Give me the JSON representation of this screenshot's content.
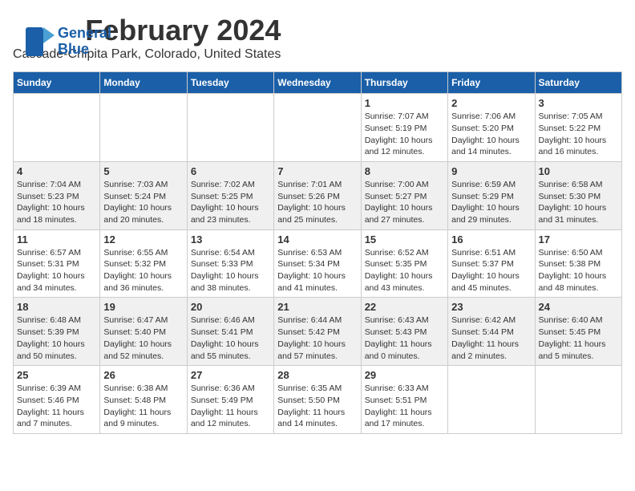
{
  "logo": {
    "line1": "General",
    "line2": "Blue"
  },
  "header": {
    "month": "February 2024",
    "location": "Cascade-Chipita Park, Colorado, United States"
  },
  "weekdays": [
    "Sunday",
    "Monday",
    "Tuesday",
    "Wednesday",
    "Thursday",
    "Friday",
    "Saturday"
  ],
  "weeks": [
    [
      {
        "day": "",
        "sunrise": "",
        "sunset": "",
        "daylight": ""
      },
      {
        "day": "",
        "sunrise": "",
        "sunset": "",
        "daylight": ""
      },
      {
        "day": "",
        "sunrise": "",
        "sunset": "",
        "daylight": ""
      },
      {
        "day": "",
        "sunrise": "",
        "sunset": "",
        "daylight": ""
      },
      {
        "day": "1",
        "sunrise": "7:07 AM",
        "sunset": "5:19 PM",
        "daylight": "10 hours and 12 minutes."
      },
      {
        "day": "2",
        "sunrise": "7:06 AM",
        "sunset": "5:20 PM",
        "daylight": "10 hours and 14 minutes."
      },
      {
        "day": "3",
        "sunrise": "7:05 AM",
        "sunset": "5:22 PM",
        "daylight": "10 hours and 16 minutes."
      }
    ],
    [
      {
        "day": "4",
        "sunrise": "7:04 AM",
        "sunset": "5:23 PM",
        "daylight": "10 hours and 18 minutes."
      },
      {
        "day": "5",
        "sunrise": "7:03 AM",
        "sunset": "5:24 PM",
        "daylight": "10 hours and 20 minutes."
      },
      {
        "day": "6",
        "sunrise": "7:02 AM",
        "sunset": "5:25 PM",
        "daylight": "10 hours and 23 minutes."
      },
      {
        "day": "7",
        "sunrise": "7:01 AM",
        "sunset": "5:26 PM",
        "daylight": "10 hours and 25 minutes."
      },
      {
        "day": "8",
        "sunrise": "7:00 AM",
        "sunset": "5:27 PM",
        "daylight": "10 hours and 27 minutes."
      },
      {
        "day": "9",
        "sunrise": "6:59 AM",
        "sunset": "5:29 PM",
        "daylight": "10 hours and 29 minutes."
      },
      {
        "day": "10",
        "sunrise": "6:58 AM",
        "sunset": "5:30 PM",
        "daylight": "10 hours and 31 minutes."
      }
    ],
    [
      {
        "day": "11",
        "sunrise": "6:57 AM",
        "sunset": "5:31 PM",
        "daylight": "10 hours and 34 minutes."
      },
      {
        "day": "12",
        "sunrise": "6:55 AM",
        "sunset": "5:32 PM",
        "daylight": "10 hours and 36 minutes."
      },
      {
        "day": "13",
        "sunrise": "6:54 AM",
        "sunset": "5:33 PM",
        "daylight": "10 hours and 38 minutes."
      },
      {
        "day": "14",
        "sunrise": "6:53 AM",
        "sunset": "5:34 PM",
        "daylight": "10 hours and 41 minutes."
      },
      {
        "day": "15",
        "sunrise": "6:52 AM",
        "sunset": "5:35 PM",
        "daylight": "10 hours and 43 minutes."
      },
      {
        "day": "16",
        "sunrise": "6:51 AM",
        "sunset": "5:37 PM",
        "daylight": "10 hours and 45 minutes."
      },
      {
        "day": "17",
        "sunrise": "6:50 AM",
        "sunset": "5:38 PM",
        "daylight": "10 hours and 48 minutes."
      }
    ],
    [
      {
        "day": "18",
        "sunrise": "6:48 AM",
        "sunset": "5:39 PM",
        "daylight": "10 hours and 50 minutes."
      },
      {
        "day": "19",
        "sunrise": "6:47 AM",
        "sunset": "5:40 PM",
        "daylight": "10 hours and 52 minutes."
      },
      {
        "day": "20",
        "sunrise": "6:46 AM",
        "sunset": "5:41 PM",
        "daylight": "10 hours and 55 minutes."
      },
      {
        "day": "21",
        "sunrise": "6:44 AM",
        "sunset": "5:42 PM",
        "daylight": "10 hours and 57 minutes."
      },
      {
        "day": "22",
        "sunrise": "6:43 AM",
        "sunset": "5:43 PM",
        "daylight": "11 hours and 0 minutes."
      },
      {
        "day": "23",
        "sunrise": "6:42 AM",
        "sunset": "5:44 PM",
        "daylight": "11 hours and 2 minutes."
      },
      {
        "day": "24",
        "sunrise": "6:40 AM",
        "sunset": "5:45 PM",
        "daylight": "11 hours and 5 minutes."
      }
    ],
    [
      {
        "day": "25",
        "sunrise": "6:39 AM",
        "sunset": "5:46 PM",
        "daylight": "11 hours and 7 minutes."
      },
      {
        "day": "26",
        "sunrise": "6:38 AM",
        "sunset": "5:48 PM",
        "daylight": "11 hours and 9 minutes."
      },
      {
        "day": "27",
        "sunrise": "6:36 AM",
        "sunset": "5:49 PM",
        "daylight": "11 hours and 12 minutes."
      },
      {
        "day": "28",
        "sunrise": "6:35 AM",
        "sunset": "5:50 PM",
        "daylight": "11 hours and 14 minutes."
      },
      {
        "day": "29",
        "sunrise": "6:33 AM",
        "sunset": "5:51 PM",
        "daylight": "11 hours and 17 minutes."
      },
      {
        "day": "",
        "sunrise": "",
        "sunset": "",
        "daylight": ""
      },
      {
        "day": "",
        "sunrise": "",
        "sunset": "",
        "daylight": ""
      }
    ]
  ],
  "labels": {
    "sunrise_prefix": "Sunrise: ",
    "sunset_prefix": "Sunset: ",
    "daylight_prefix": "Daylight: "
  }
}
